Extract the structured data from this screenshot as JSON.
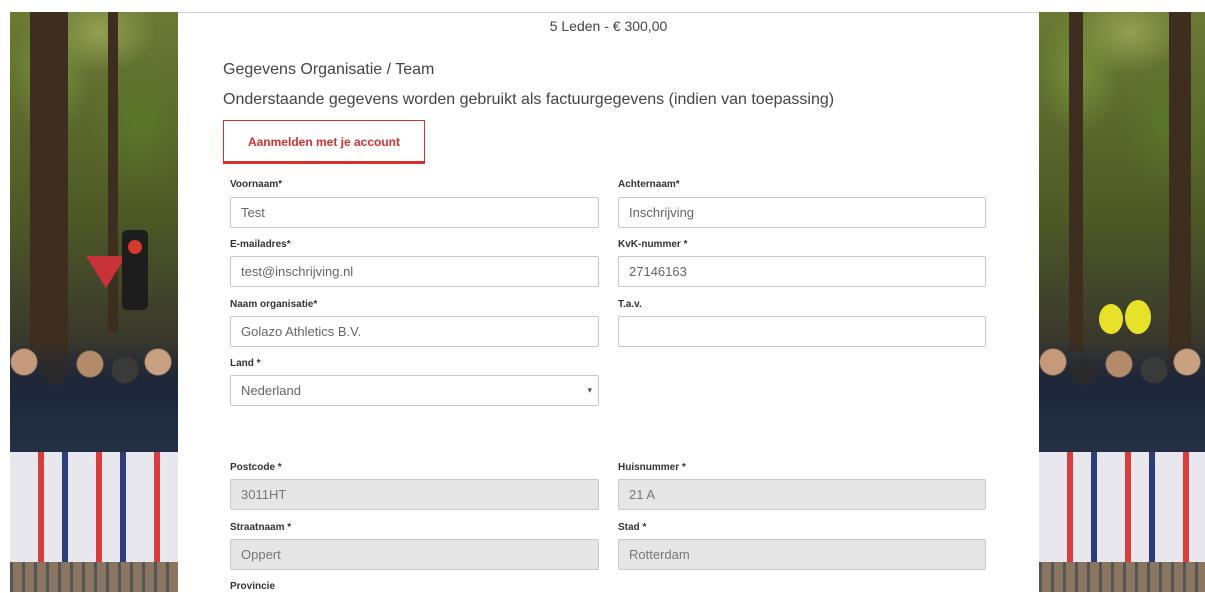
{
  "header": {
    "subtitle": "5 Leden - € 300,00"
  },
  "section": {
    "title": "Gegevens Organisatie / Team",
    "description": "Onderstaande gegevens worden gebruikt als factuurgegevens (indien van toepassing)"
  },
  "login_button": {
    "label": "Aanmelden met je account"
  },
  "form": {
    "voornaam": {
      "label": "Voornaam*",
      "value": "Test"
    },
    "achternaam": {
      "label": "Achternaam*",
      "value": "Inschrijving"
    },
    "email": {
      "label": "E-mailadres*",
      "value": "test@inschrijving.nl"
    },
    "kvk": {
      "label": "KvK-nummer *",
      "value": "27146163"
    },
    "organisatie": {
      "label": "Naam organisatie*",
      "value": "Golazo Athletics B.V."
    },
    "tav": {
      "label": "T.a.v.",
      "value": ""
    },
    "land": {
      "label": "Land *",
      "value": "Nederland",
      "arrow": "▾"
    },
    "postcode": {
      "label": "Postcode *",
      "value": "3011HT"
    },
    "huisnummer": {
      "label": "Huisnummer *",
      "value": "21 A"
    },
    "straatnaam": {
      "label": "Straatnaam *",
      "value": "Oppert"
    },
    "stad": {
      "label": "Stad *",
      "value": "Rotterdam"
    },
    "provincie": {
      "label": "Provincie"
    }
  },
  "colors": {
    "accent": "#d3312f",
    "readonly_bg": "#e6e6e6",
    "border": "#c8c8c8"
  },
  "images": {
    "left_panel": "race-crowd-photo-left",
    "right_panel": "race-crowd-photo-right"
  }
}
